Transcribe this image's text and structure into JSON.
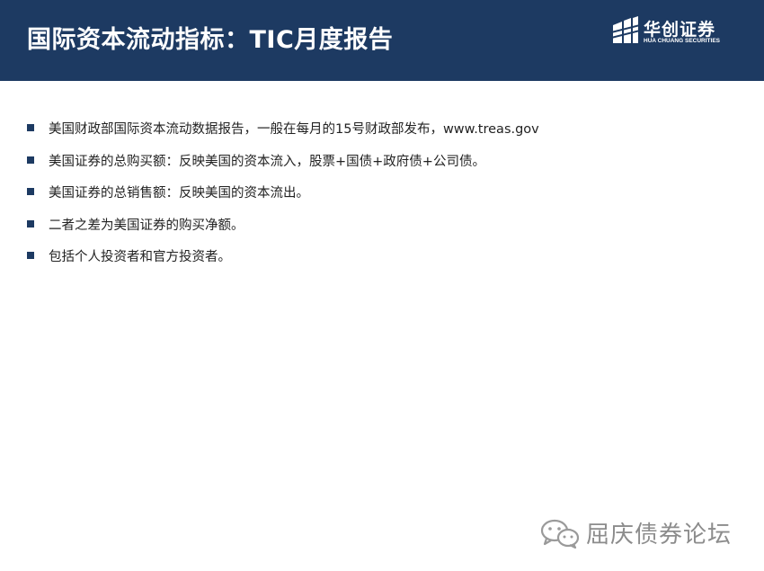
{
  "header": {
    "title": "国际资本流动指标：TIC月度报告",
    "background_color": "#1d3a62"
  },
  "logo": {
    "name_cn": "华创证券",
    "name_en": "HUA CHUANG SECURITIES",
    "icon": "huachuang-logo-icon"
  },
  "bullets": [
    {
      "text": "美国财政部国际资本流动数据报告，一般在每月的15号财政部发布，www.treas.gov"
    },
    {
      "text": "美国证券的总购买额：反映美国的资本流入，股票+国债+政府债+公司债。"
    },
    {
      "text": "美国证券的总销售额：反映美国的资本流出。"
    },
    {
      "text": "二者之差为美国证券的购买净额。"
    },
    {
      "text": "包括个人投资者和官方投资者。"
    }
  ],
  "watermark": {
    "icon": "wechat-icon",
    "text": "屈庆债券论坛"
  }
}
